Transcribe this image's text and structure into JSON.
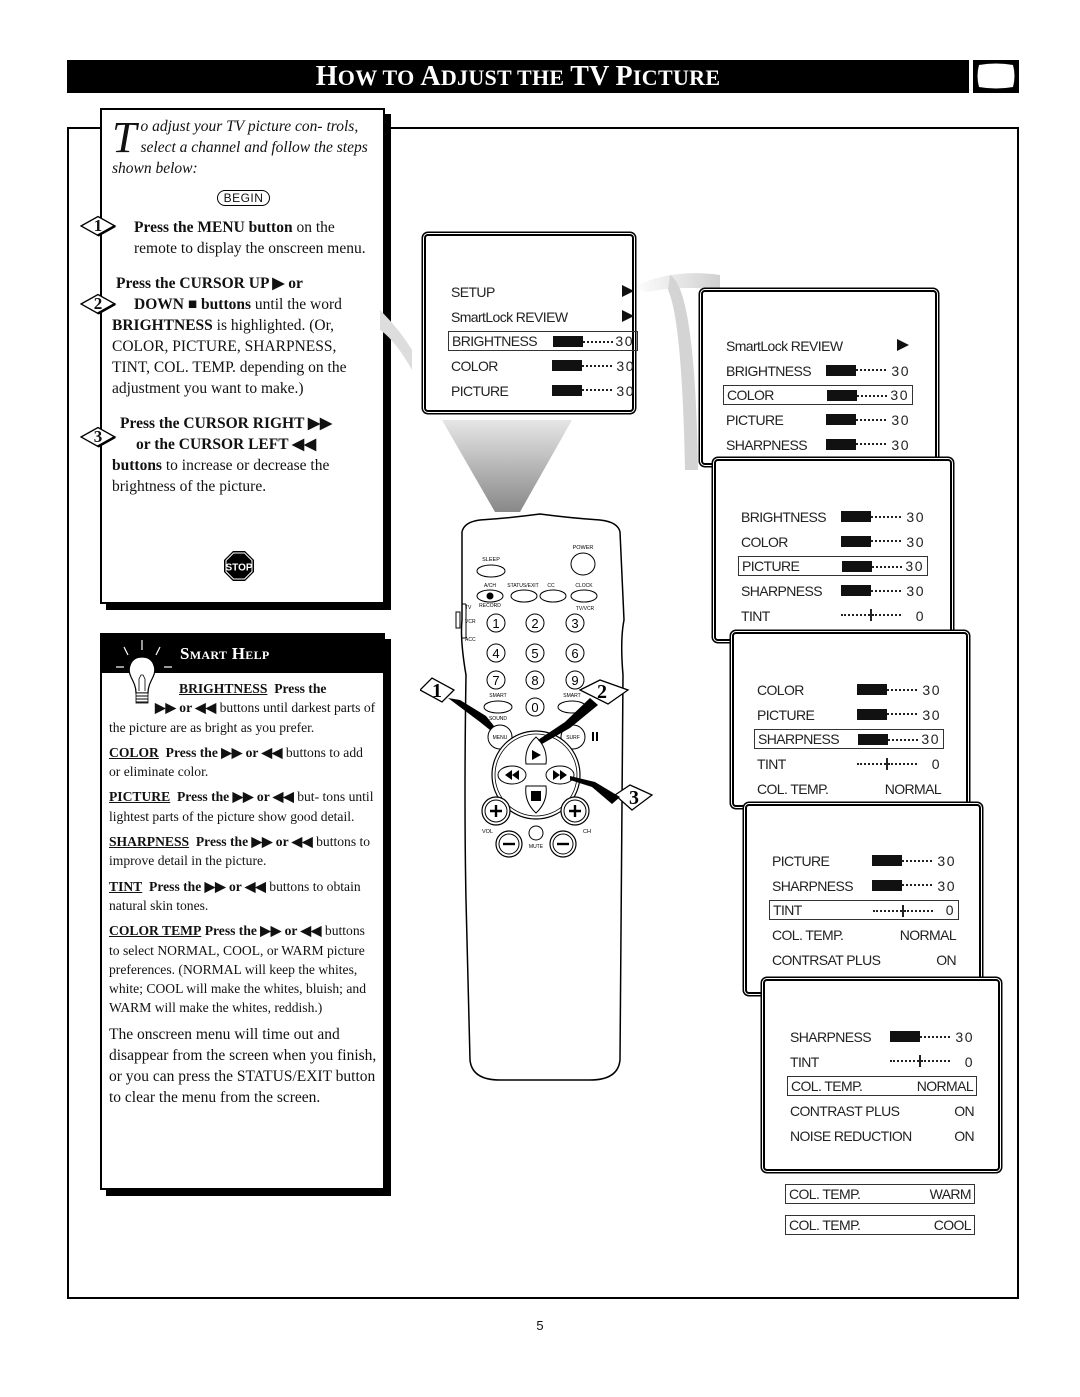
{
  "header": {
    "title_parts": [
      {
        "cap": "H",
        "rest": "OW TO "
      },
      {
        "cap": "A",
        "rest": "DJUST THE "
      },
      {
        "cap": "TV",
        "rest": " "
      },
      {
        "cap": "P",
        "rest": "ICTURE"
      }
    ],
    "icon": "tv-screen-icon"
  },
  "intro": {
    "dropcap": "T",
    "text": "o adjust your TV picture con- trols, select a channel and follow the steps shown below:",
    "begin_label": "BEGIN"
  },
  "steps": [
    {
      "number": "1",
      "bold": "Press the MENU button",
      "text": " on the remote to display the onscreen menu."
    },
    {
      "number": "2",
      "bold_line1": "Press the CURSOR UP ▶ or",
      "bold_line2": "DOWN ■ buttons",
      "text_after_line2": " until the word",
      "bold_word": "BRIGHTNESS",
      "text": " is highlighted. (Or, COLOR, PICTURE, SHARPNESS, TINT, COL. TEMP. depending on the adjustment you want to make.)"
    },
    {
      "number": "3",
      "bold_line1": "Press the CURSOR RIGHT ▶▶",
      "bold_line2": "or the CURSOR LEFT ◀◀",
      "bold_word": "buttons",
      "text": " to increase or decrease the brightness of the picture."
    }
  ],
  "stop_icon_label": "STOP",
  "smart_help": {
    "title": "Smart Help",
    "icon": "lightbulb-icon",
    "items": [
      {
        "term": "BRIGHTNESS",
        "press": "Press the",
        "arrows": "▶▶ or ◀◀",
        "text": " buttons until darkest parts of the picture are as bright as you prefer."
      },
      {
        "term": "COLOR",
        "press": "Press the ▶▶ or ◀◀",
        "text": " buttons to add or eliminate color."
      },
      {
        "term": "PICTURE",
        "press": "Press the ▶▶ or ◀◀",
        "text": " but- tons until lightest parts of the picture show good detail."
      },
      {
        "term": "SHARPNESS",
        "press": "Press the ▶▶ or ◀◀",
        "text": " buttons to improve detail in the picture."
      },
      {
        "term": "TINT",
        "press": "Press the ▶▶ or ◀◀",
        "text": " buttons to obtain natural skin tones."
      },
      {
        "term": "COLOR TEMP",
        "press": "Press the ▶▶ or ◀◀",
        "text": " buttons to select NORMAL, COOL, or WARM picture preferences. (NORMAL will keep the whites, white; COOL will make the whites, bluish; and WARM will make the whites, reddish.)"
      }
    ],
    "footer": "The onscreen menu will time out and disappear from the screen when you finish, or you can press the STATUS/EXIT button to clear the menu from the screen."
  },
  "menus": [
    {
      "rows": [
        {
          "label": "SETUP",
          "type": "arrow"
        },
        {
          "label": "SmartLock REVIEW",
          "type": "arrow"
        },
        {
          "label": "BRIGHTNESS",
          "type": "bar",
          "value": "30",
          "level": 0.5,
          "highlight": true
        },
        {
          "label": "COLOR",
          "type": "bar",
          "value": "30",
          "level": 0.5
        },
        {
          "label": "PICTURE",
          "type": "bar",
          "value": "30",
          "level": 0.5
        }
      ]
    },
    {
      "rows": [
        {
          "label": "SmartLock REVIEW",
          "type": "arrow"
        },
        {
          "label": "BRIGHTNESS",
          "type": "bar",
          "value": "30",
          "level": 0.5
        },
        {
          "label": "COLOR",
          "type": "bar",
          "value": "30",
          "level": 0.5,
          "highlight": true
        },
        {
          "label": "PICTURE",
          "type": "bar",
          "value": "30",
          "level": 0.5
        },
        {
          "label": "SHARPNESS",
          "type": "bar",
          "value": "30",
          "level": 0.5
        }
      ]
    },
    {
      "rows": [
        {
          "label": "BRIGHTNESS",
          "type": "bar",
          "value": "30",
          "level": 0.5
        },
        {
          "label": "COLOR",
          "type": "bar",
          "value": "30",
          "level": 0.5
        },
        {
          "label": "PICTURE",
          "type": "bar",
          "value": "30",
          "level": 0.5,
          "highlight": true
        },
        {
          "label": "SHARPNESS",
          "type": "bar",
          "value": "30",
          "level": 0.5
        },
        {
          "label": "TINT",
          "type": "tint",
          "value": "0",
          "level": 0.5
        }
      ]
    },
    {
      "rows": [
        {
          "label": "COLOR",
          "type": "bar",
          "value": "30",
          "level": 0.5
        },
        {
          "label": "PICTURE",
          "type": "bar",
          "value": "30",
          "level": 0.5
        },
        {
          "label": "SHARPNESS",
          "type": "bar",
          "value": "30",
          "level": 0.5,
          "highlight": true
        },
        {
          "label": "TINT",
          "type": "tint",
          "value": "0",
          "level": 0.5
        },
        {
          "label": "COL. TEMP.",
          "type": "text",
          "value": "NORMAL"
        }
      ]
    },
    {
      "rows": [
        {
          "label": "PICTURE",
          "type": "bar",
          "value": "30",
          "level": 0.5
        },
        {
          "label": "SHARPNESS",
          "type": "bar",
          "value": "30",
          "level": 0.5
        },
        {
          "label": "TINT",
          "type": "tint",
          "value": "0",
          "level": 0.5,
          "highlight": true
        },
        {
          "label": "COL. TEMP.",
          "type": "text",
          "value": "NORMAL"
        },
        {
          "label": "CONTRSAT PLUS",
          "type": "text",
          "value": "ON"
        }
      ]
    },
    {
      "rows": [
        {
          "label": "SHARPNESS",
          "type": "bar",
          "value": "30",
          "level": 0.5
        },
        {
          "label": "TINT",
          "type": "tint",
          "value": "0",
          "level": 0.5
        },
        {
          "label": "COL. TEMP.",
          "type": "text",
          "value": "NORMAL",
          "highlight": true
        },
        {
          "label": "CONTRAST PLUS",
          "type": "text",
          "value": "ON"
        },
        {
          "label": "NOISE REDUCTION",
          "type": "text",
          "value": "ON"
        }
      ]
    }
  ],
  "col_temp_options": [
    {
      "label": "COL. TEMP.",
      "value": "WARM"
    },
    {
      "label": "COL. TEMP.",
      "value": "COOL"
    }
  ],
  "remote": {
    "buttons": {
      "power": "POWER",
      "sleep": "SLEEP",
      "ach": "A/CH",
      "status_exit": "STATUS/EXIT",
      "cc": "CC",
      "clock": "CLOCK",
      "record": "RECORD",
      "tv_vcr": "TV/VCR",
      "tv": "TV",
      "vcr": "VCR",
      "acc": "ACC",
      "smart_sound_top": "SMART",
      "smart_sound_bottom": "SOUND",
      "smart_pic": "SMART",
      "menu": "MENU",
      "surf": "SURF",
      "vol": "VOL",
      "ch": "CH",
      "mute": "MUTE",
      "digits": [
        "1",
        "2",
        "3",
        "4",
        "5",
        "6",
        "7",
        "8",
        "9",
        "0"
      ]
    },
    "callouts": [
      "1",
      "2",
      "3"
    ]
  },
  "page_number": "5"
}
